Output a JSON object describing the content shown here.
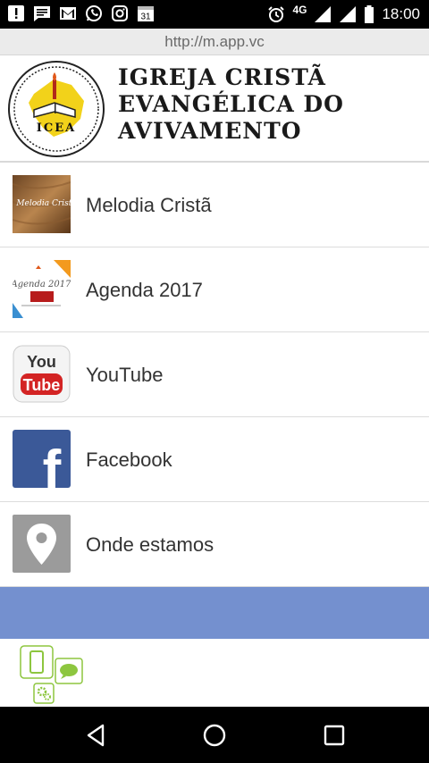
{
  "status_bar": {
    "time": "18:00",
    "network": "4G",
    "calendar_day": "31",
    "icons": [
      "alert-icon",
      "message-icon",
      "gmail-icon",
      "whatsapp-icon",
      "instagram-icon",
      "calendar-icon",
      "alarm-icon",
      "signal-icon",
      "signal-icon",
      "battery-icon"
    ]
  },
  "browser": {
    "url": "http://m.app.vc"
  },
  "header": {
    "logo_text": "ICEA",
    "title_lines": [
      "IGREJA CRISTÃ",
      "EVANGÉLICA DO",
      "AVIVAMENTO"
    ]
  },
  "menu": {
    "items": [
      {
        "label": "Melodia Cristã",
        "thumb_text": "Melodia Cristã"
      },
      {
        "label": "Agenda 2017",
        "thumb_text": "Agenda 2017"
      },
      {
        "label": "YouTube",
        "thumb_text_1": "You",
        "thumb_text_2": "Tube"
      },
      {
        "label": "Facebook",
        "thumb_text": "f"
      },
      {
        "label": "Onde estamos"
      }
    ]
  },
  "colors": {
    "band": "#7490cf",
    "facebook": "#3b5998",
    "youtube_red": "#d32424",
    "location_gray": "#9b9b9b",
    "app_icon_green": "#8dc63f"
  }
}
